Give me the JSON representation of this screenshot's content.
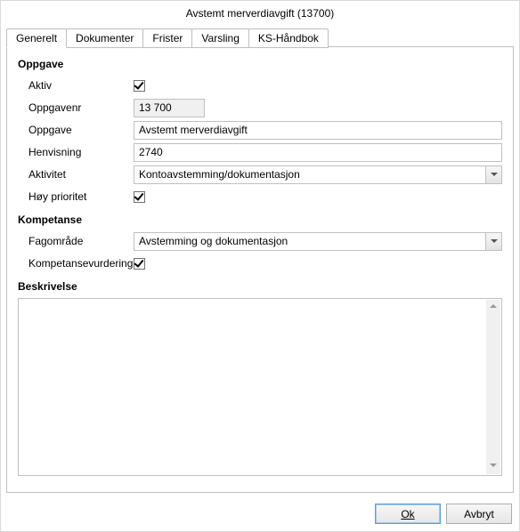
{
  "title": "Avstemt merverdiavgift (13700)",
  "tabs": {
    "generelt": "Generelt",
    "dokumenter": "Dokumenter",
    "frister": "Frister",
    "varsling": "Varsling",
    "kshandbok": "KS-Håndbok"
  },
  "sections": {
    "oppgave": "Oppgave",
    "kompetanse": "Kompetanse",
    "beskrivelse": "Beskrivelse"
  },
  "labels": {
    "aktiv": "Aktiv",
    "oppgavenr": "Oppgavenr",
    "oppgave": "Oppgave",
    "henvisning": "Henvisning",
    "aktivitet": "Aktivitet",
    "hoy_prioritet": "Høy prioritet",
    "fagomrade": "Fagområde",
    "kompetansevurdering": "Kompetansevurdering"
  },
  "values": {
    "oppgavenr": "13 700",
    "oppgave": "Avstemt merverdiavgift",
    "henvisning": "2740",
    "aktivitet": "Kontoavstemming/dokumentasjon",
    "fagomrade": "Avstemming og dokumentasjon",
    "beskrivelse": ""
  },
  "checks": {
    "aktiv": true,
    "hoy_prioritet": true,
    "kompetansevurdering": true
  },
  "buttons": {
    "ok": "Ok",
    "avbryt": "Avbryt"
  }
}
